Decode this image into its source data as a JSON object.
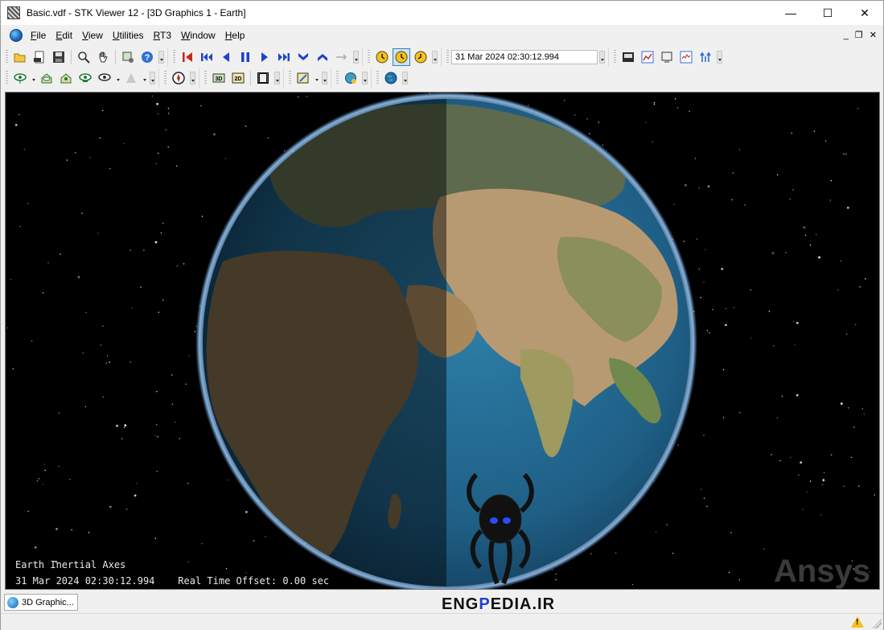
{
  "window": {
    "title": "Basic.vdf - STK Viewer 12 - [3D Graphics 1 - Earth]"
  },
  "window_controls": {
    "minimize": "—",
    "maximize": "☐",
    "close": "✕"
  },
  "menu": {
    "items": [
      {
        "label": "File",
        "key": "F"
      },
      {
        "label": "Edit",
        "key": "E"
      },
      {
        "label": "View",
        "key": "V"
      },
      {
        "label": "Utilities",
        "key": "U"
      },
      {
        "label": "RT3",
        "key": "R"
      },
      {
        "label": "Window",
        "key": "W"
      },
      {
        "label": "Help",
        "key": "H"
      }
    ],
    "mdi_minimize": "_",
    "mdi_restore": "❐",
    "mdi_close": "✕"
  },
  "toolbar": {
    "file_buttons": [
      "open-icon",
      "vdf-icon",
      "save-icon"
    ],
    "animation_time": "31 Mar 2024 02:30:12.994",
    "animation_mode": "realtime"
  },
  "viewport": {
    "hud_axes": "Earth Inertial Axes",
    "hud_time": "31 Mar 2024 02:30:12.994",
    "hud_offset": "Real Time Offset: 0.00 sec",
    "brand_logo": "Ansys",
    "terminator_fraction": 0.5
  },
  "tabs": [
    {
      "label": "3D Graphic..."
    }
  ],
  "watermark": {
    "prefix": "ENG",
    "highlight": "P",
    "suffix": "EDIA.IR"
  },
  "colors": {
    "space": "#000000",
    "ocean": "#1f5f86",
    "land_day": "#b89a72",
    "land_night": "#3a3528",
    "atmosphere": "#6fb6ff",
    "accent": "#1e3fd0"
  }
}
